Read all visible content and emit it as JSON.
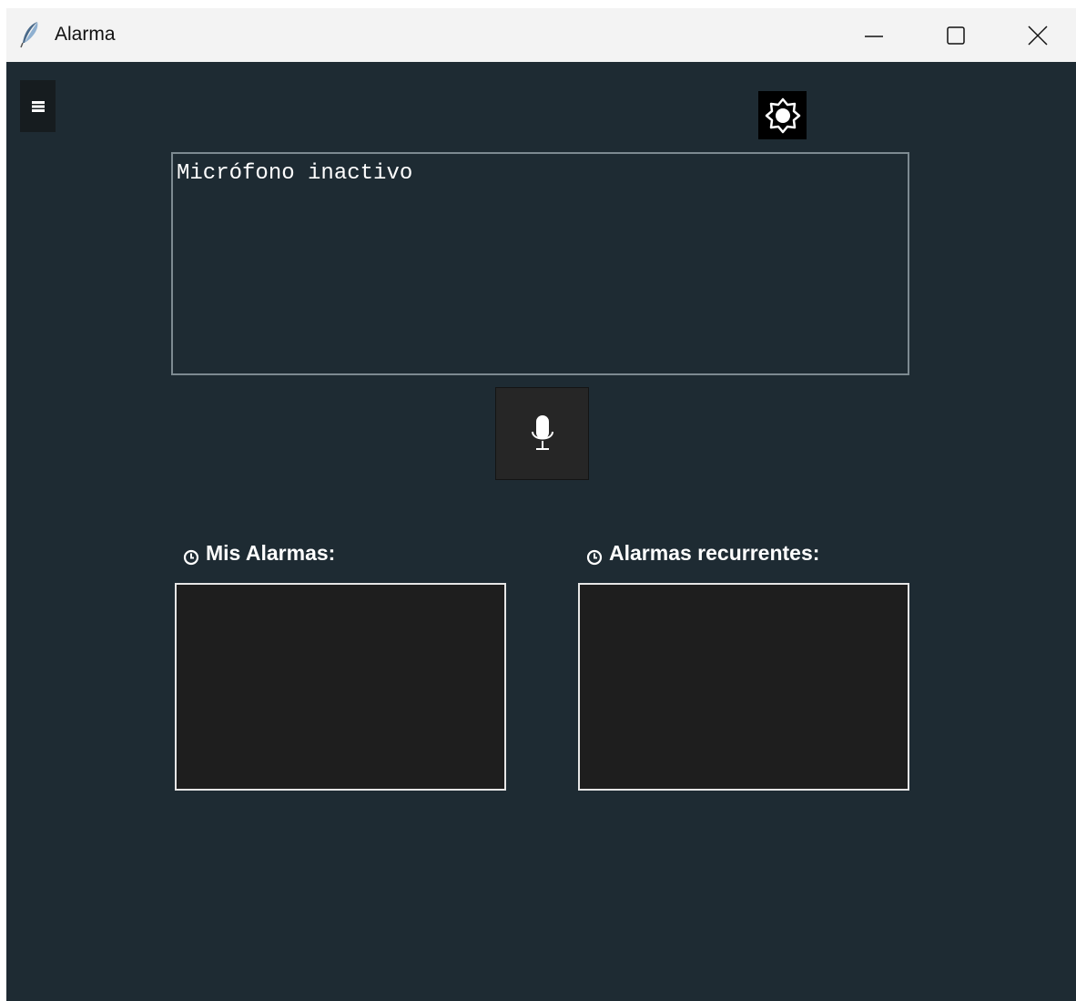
{
  "window": {
    "title": "Alarma"
  },
  "colors": {
    "background": "#1e2b33",
    "titlebar": "#f3f3f3",
    "listbox_bg": "#1e1e1e",
    "mic_button_bg": "#262626",
    "text": "#ffffff"
  },
  "icons": {
    "app": "feather-icon",
    "menu": "hamburger-menu-icon",
    "theme": "brightness-icon",
    "mic": "microphone-icon",
    "clock": "clock-icon"
  },
  "transcript": {
    "text": "Micrófono inactivo"
  },
  "alarms": {
    "label": "Mis Alarmas:",
    "items": []
  },
  "recurring": {
    "label": "Alarmas recurrentes:",
    "items": []
  }
}
